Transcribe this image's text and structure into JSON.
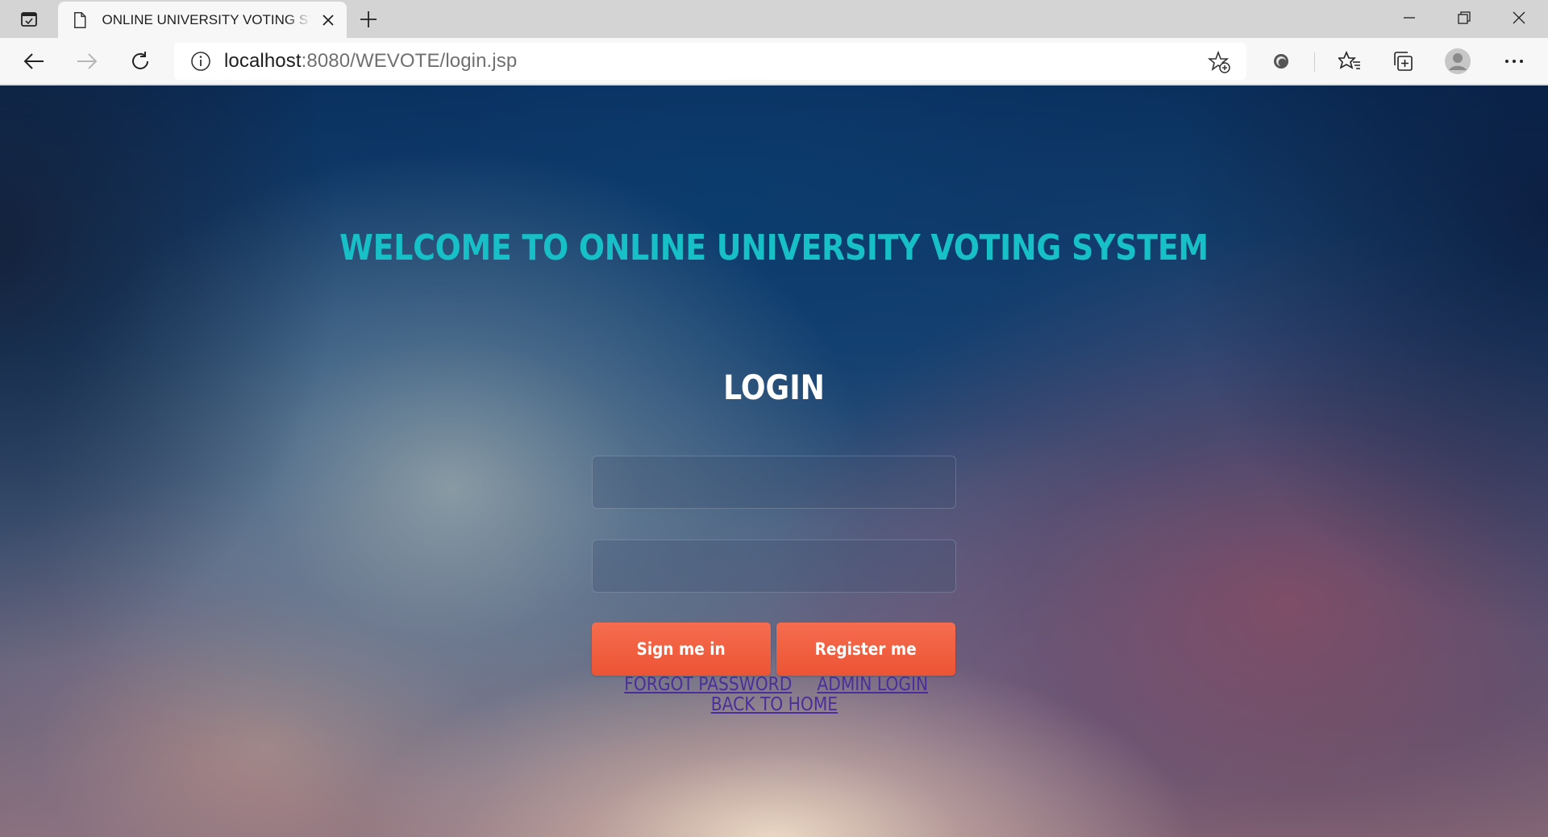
{
  "browser": {
    "tab_title": "ONLINE UNIVERSITY VOTING SYSTEM",
    "address": {
      "host": "localhost",
      "path": ":8080/WEVOTE/login.jsp"
    }
  },
  "page": {
    "welcome": "WELCOME TO ONLINE UNIVERSITY VOTING SYSTEM",
    "login_heading": "LOGIN",
    "username_value": "",
    "password_value": "",
    "sign_in_label": "Sign me in",
    "register_label": "Register me",
    "forgot_password": "FORGOT PASSWORD",
    "admin_login": "ADMIN LOGIN",
    "back_home": "BACK TO HOME"
  },
  "colors": {
    "welcome": "#17bfc6",
    "button": "#ef5b3b",
    "link": "#4a2f9a"
  }
}
